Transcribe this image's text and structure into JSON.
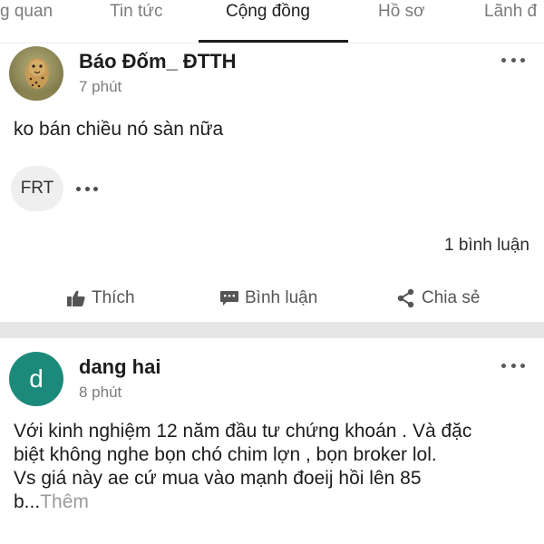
{
  "tabs": [
    {
      "label": "g quan"
    },
    {
      "label": "Tin tức"
    },
    {
      "label": "Cộng đồng",
      "active": true
    },
    {
      "label": "Hồ sơ"
    },
    {
      "label": "Lãnh đ"
    }
  ],
  "posts": [
    {
      "author": "Báo Đốm_ ĐTTH",
      "time": "7 phút",
      "body_lines": [
        "ko bán chiều nó sàn nữa"
      ],
      "tag": "FRT",
      "comment_count": "1 bình luận",
      "actions": {
        "like": "Thích",
        "comment": "Bình luận",
        "share": "Chia sẻ"
      }
    },
    {
      "author": "dang hai",
      "avatar_letter": "d",
      "avatar_color": "#1c8a7b",
      "time": "8 phút",
      "body_lines": [
        "Với kinh nghiệm 12 năm đầu tư chứng khoán . Và đặc",
        "biệt không nghe bọn chó chim lợn , bọn broker lol.",
        "Vs giá này ae cứ mua vào mạnh đoeij hồi lên 85"
      ],
      "body_tail": "b...",
      "see_more": "Thêm"
    }
  ],
  "colors": {
    "text": "#1c1c1c",
    "muted": "#7c7c7c",
    "separator": "#e6e6e6",
    "accent_avatar": "#1c8a7b"
  }
}
